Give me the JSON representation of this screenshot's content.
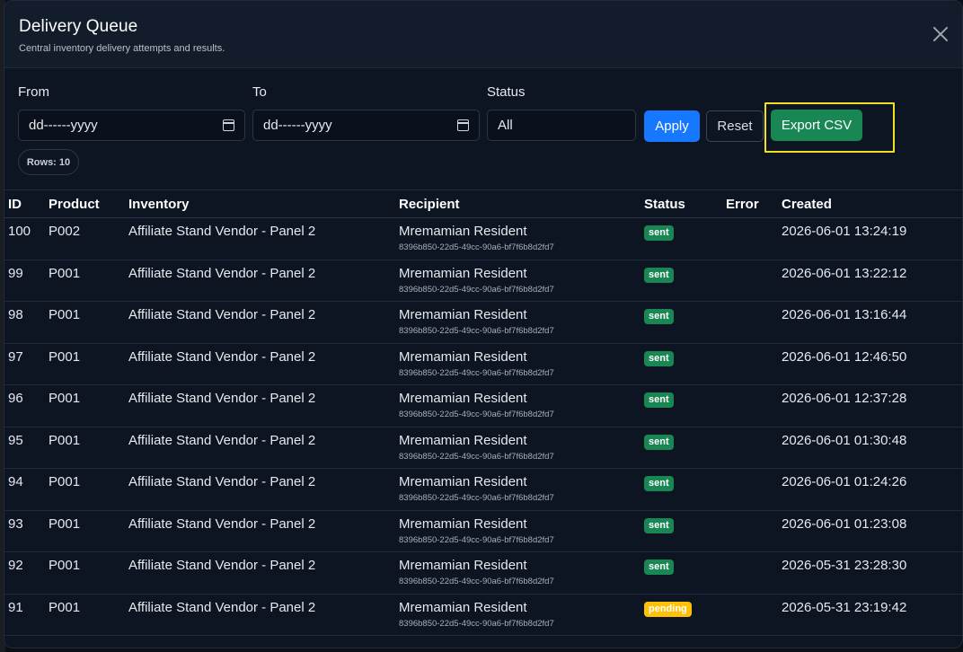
{
  "modal": {
    "title": "Delivery Queue",
    "subtitle": "Central inventory delivery attempts and results."
  },
  "filters": {
    "from_label": "From",
    "from_value": "dd------yyyy",
    "to_label": "To",
    "to_value": "dd------yyyy",
    "status_label": "Status",
    "status_value": "All",
    "apply_label": "Apply",
    "reset_label": "Reset",
    "export_label": "Export CSV",
    "highlight_color": "#f2e020",
    "rows_label": "Rows: 10"
  },
  "table": {
    "columns": [
      "ID",
      "Product",
      "Inventory",
      "Recipient",
      "Status",
      "Error",
      "Created"
    ],
    "rows": [
      {
        "id": "100",
        "product": "P002",
        "inventory": "Affiliate Stand Vendor - Panel 2",
        "recipient": "Mremamian Resident",
        "recipient_id": "8396b850-22d5-49cc-90a6-bf7f6b8d2fd7",
        "status": "sent",
        "error": "",
        "created": "2026-06-01 13:24:19"
      },
      {
        "id": "99",
        "product": "P001",
        "inventory": "Affiliate Stand Vendor - Panel 2",
        "recipient": "Mremamian Resident",
        "recipient_id": "8396b850-22d5-49cc-90a6-bf7f6b8d2fd7",
        "status": "sent",
        "error": "",
        "created": "2026-06-01 13:22:12"
      },
      {
        "id": "98",
        "product": "P001",
        "inventory": "Affiliate Stand Vendor - Panel 2",
        "recipient": "Mremamian Resident",
        "recipient_id": "8396b850-22d5-49cc-90a6-bf7f6b8d2fd7",
        "status": "sent",
        "error": "",
        "created": "2026-06-01 13:16:44"
      },
      {
        "id": "97",
        "product": "P001",
        "inventory": "Affiliate Stand Vendor - Panel 2",
        "recipient": "Mremamian Resident",
        "recipient_id": "8396b850-22d5-49cc-90a6-bf7f6b8d2fd7",
        "status": "sent",
        "error": "",
        "created": "2026-06-01 12:46:50"
      },
      {
        "id": "96",
        "product": "P001",
        "inventory": "Affiliate Stand Vendor - Panel 2",
        "recipient": "Mremamian Resident",
        "recipient_id": "8396b850-22d5-49cc-90a6-bf7f6b8d2fd7",
        "status": "sent",
        "error": "",
        "created": "2026-06-01 12:37:28"
      },
      {
        "id": "95",
        "product": "P001",
        "inventory": "Affiliate Stand Vendor - Panel 2",
        "recipient": "Mremamian Resident",
        "recipient_id": "8396b850-22d5-49cc-90a6-bf7f6b8d2fd7",
        "status": "sent",
        "error": "",
        "created": "2026-06-01 01:30:48"
      },
      {
        "id": "94",
        "product": "P001",
        "inventory": "Affiliate Stand Vendor - Panel 2",
        "recipient": "Mremamian Resident",
        "recipient_id": "8396b850-22d5-49cc-90a6-bf7f6b8d2fd7",
        "status": "sent",
        "error": "",
        "created": "2026-06-01 01:24:26"
      },
      {
        "id": "93",
        "product": "P001",
        "inventory": "Affiliate Stand Vendor - Panel 2",
        "recipient": "Mremamian Resident",
        "recipient_id": "8396b850-22d5-49cc-90a6-bf7f6b8d2fd7",
        "status": "sent",
        "error": "",
        "created": "2026-06-01 01:23:08"
      },
      {
        "id": "92",
        "product": "P001",
        "inventory": "Affiliate Stand Vendor - Panel 2",
        "recipient": "Mremamian Resident",
        "recipient_id": "8396b850-22d5-49cc-90a6-bf7f6b8d2fd7",
        "status": "sent",
        "error": "",
        "created": "2026-05-31 23:28:30"
      },
      {
        "id": "91",
        "product": "P001",
        "inventory": "Affiliate Stand Vendor - Panel 2",
        "recipient": "Mremamian Resident",
        "recipient_id": "8396b850-22d5-49cc-90a6-bf7f6b8d2fd7",
        "status": "pending",
        "error": "",
        "created": "2026-05-31 23:19:42"
      }
    ]
  },
  "colors": {
    "sent": "#198754",
    "pending": "#ffc107",
    "apply": "#1677ff"
  },
  "icons": {
    "close": "close-icon",
    "calendar": "calendar-icon"
  }
}
